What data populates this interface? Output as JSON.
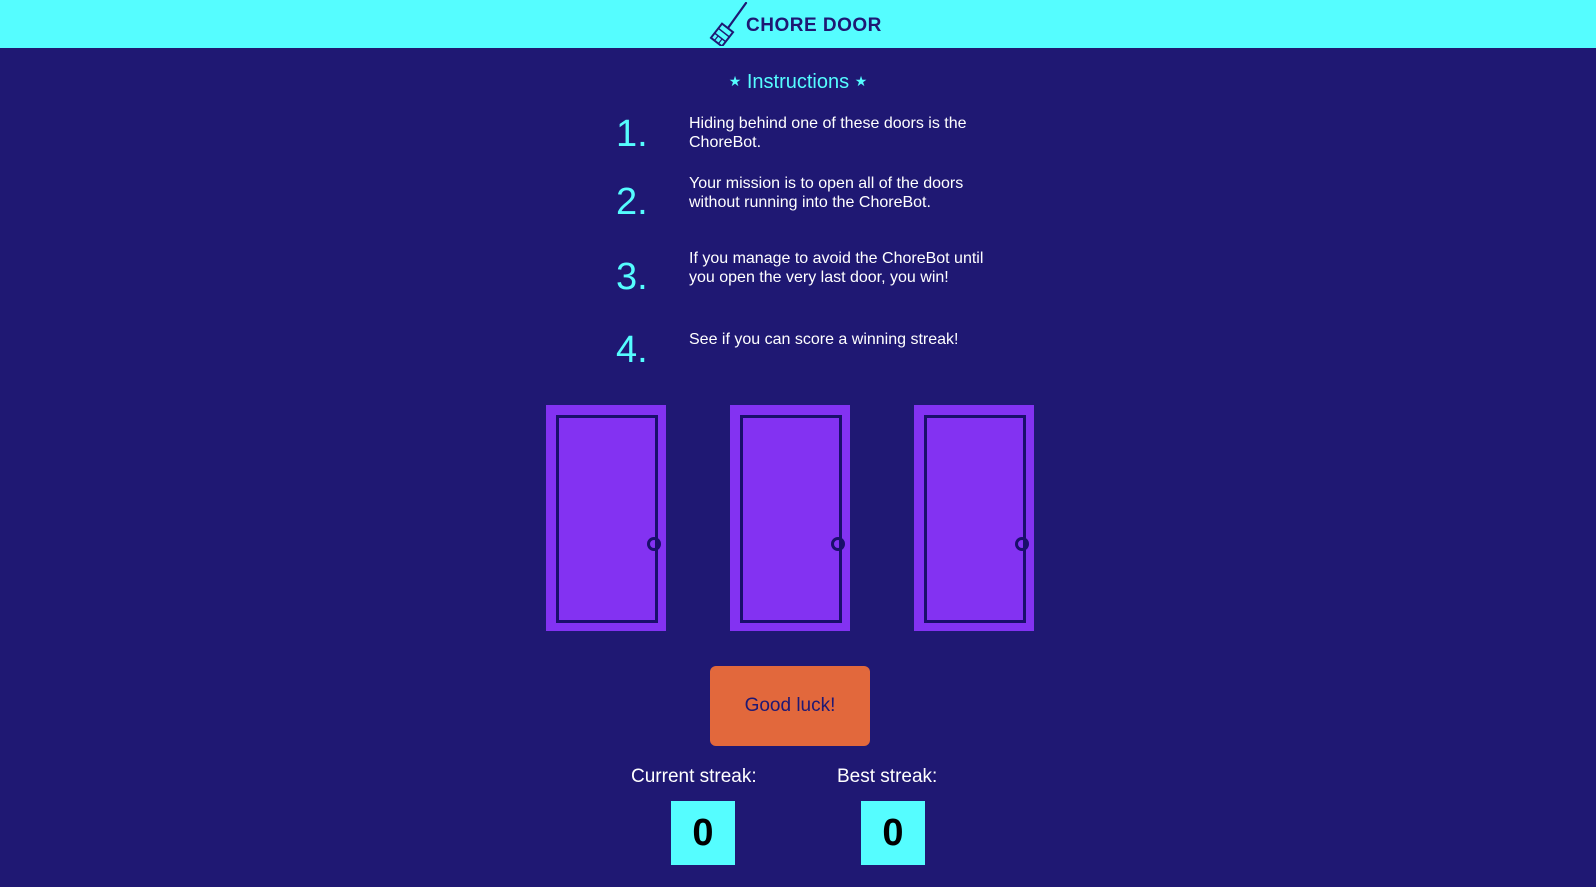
{
  "header": {
    "logo_icon": "broom-icon",
    "title": "CHORE DOOR"
  },
  "instructions": {
    "title": "Instructions",
    "star_glyph": "★",
    "steps": [
      {
        "number": "1.",
        "text": "Hiding behind one of these doors is the ChoreBot."
      },
      {
        "number": "2.",
        "text": "Your mission is to open all of the doors without running into the ChoreBot."
      },
      {
        "number": "3.",
        "text": "If you manage to avoid the ChoreBot until you open the very last door, you win!"
      },
      {
        "number": "4.",
        "text": "See if you can score a winning streak!"
      }
    ]
  },
  "doors": [
    {
      "state": "closed"
    },
    {
      "state": "closed"
    },
    {
      "state": "closed"
    }
  ],
  "start_button": {
    "label": "Good luck!"
  },
  "score": {
    "current_label": "Current streak:",
    "current_value": "0",
    "best_label": "Best streak:",
    "best_value": "0"
  },
  "colors": {
    "background": "#1f1873",
    "accent": "#55fdff",
    "door": "#8332f2",
    "button": "#e2683c"
  }
}
